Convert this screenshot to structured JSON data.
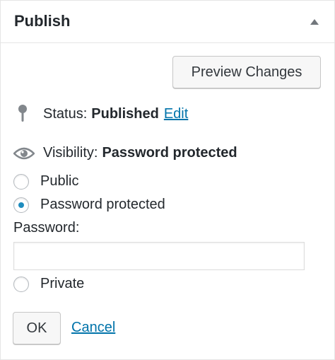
{
  "header": {
    "title": "Publish",
    "toggle_icon": "triangle-up-icon"
  },
  "preview_button": {
    "label": "Preview Changes"
  },
  "status": {
    "label": "Status:",
    "value": "Published",
    "edit_link": "Edit",
    "icon": "pin-icon"
  },
  "visibility": {
    "label": "Visibility:",
    "value": "Password protected",
    "icon": "eye-icon",
    "options": [
      {
        "label": "Public",
        "checked": false
      },
      {
        "label": "Password protected",
        "checked": true
      },
      {
        "label": "Private",
        "checked": false
      }
    ],
    "password_label": "Password:",
    "password_value": ""
  },
  "actions": {
    "ok_label": "OK",
    "cancel_label": "Cancel"
  },
  "colors": {
    "link": "#0073aa",
    "radio_selected": "#1e8cbe",
    "border": "#e5e5e5"
  }
}
